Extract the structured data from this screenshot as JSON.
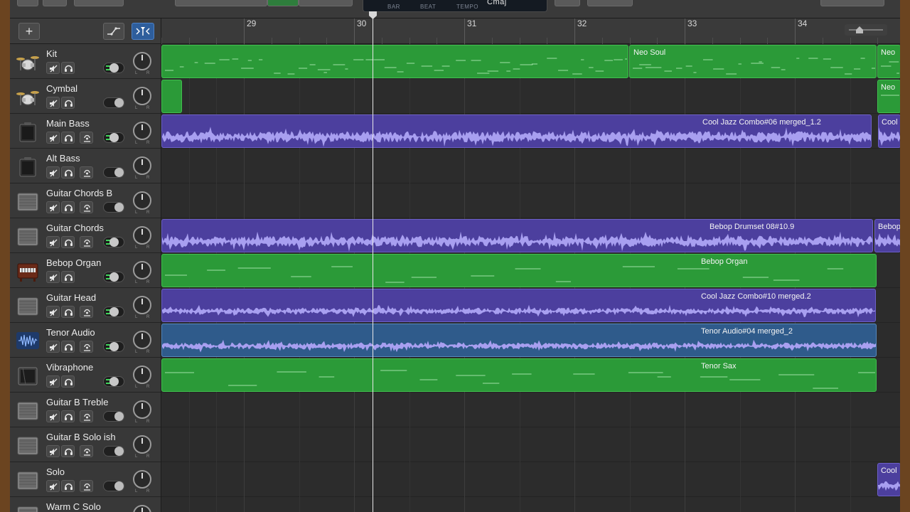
{
  "toolbar": {
    "lcd": {
      "bar_label": "BAR",
      "beat_label": "BEAT",
      "tempo_label": "TEMPO",
      "key": "Cmaj"
    }
  },
  "header_controls": {
    "add_symbol": "+"
  },
  "ruler": {
    "bars": [
      "29",
      "30",
      "31",
      "32",
      "33",
      "34"
    ]
  },
  "tracks": [
    {
      "name": "Kit",
      "icon": "drum-kit-icon",
      "toggle_on": true
    },
    {
      "name": "Cymbal",
      "icon": "drum-kit-icon",
      "toggle_on": false
    },
    {
      "name": "Main Bass",
      "icon": "bass-amp-icon",
      "toggle_on": true
    },
    {
      "name": "Alt Bass",
      "icon": "bass-amp-icon",
      "toggle_on": false
    },
    {
      "name": "Guitar Chords B",
      "icon": "guitar-amp-icon",
      "toggle_on": false
    },
    {
      "name": "Guitar Chords",
      "icon": "guitar-amp-icon",
      "toggle_on": true
    },
    {
      "name": "Bebop Organ",
      "icon": "organ-icon",
      "toggle_on": true
    },
    {
      "name": "Guitar Head",
      "icon": "guitar-amp-icon",
      "toggle_on": true
    },
    {
      "name": "Tenor Audio",
      "icon": "waveform-icon",
      "toggle_on": true
    },
    {
      "name": "Vibraphone",
      "icon": "vibraphone-amp-icon",
      "toggle_on": true
    },
    {
      "name": "Guitar B Treble",
      "icon": "guitar-amp-icon",
      "toggle_on": false
    },
    {
      "name": "Guitar B Solo ish",
      "icon": "guitar-amp-icon",
      "toggle_on": false
    },
    {
      "name": "Solo",
      "icon": "guitar-amp-icon",
      "toggle_on": false
    },
    {
      "name": "Warm C Solo",
      "icon": "guitar-amp-icon",
      "toggle_on": false
    }
  ],
  "regions": [
    {
      "track": "Kit",
      "label": "",
      "kind": "midi"
    },
    {
      "track": "Kit",
      "label": "Neo Soul",
      "kind": "midi"
    },
    {
      "track": "Kit",
      "label": "Neo",
      "kind": "midi"
    },
    {
      "track": "Cymbal",
      "label": "",
      "kind": "midi"
    },
    {
      "track": "Cymbal",
      "label": "Neo",
      "kind": "midi"
    },
    {
      "track": "Main Bass",
      "label": "Cool Jazz Combo#06 merged_1.2",
      "kind": "audio"
    },
    {
      "track": "Main Bass",
      "label": "Cool",
      "kind": "audio"
    },
    {
      "track": "Guitar Chords",
      "label": "Bebop Drumset 08#10.9",
      "kind": "audio"
    },
    {
      "track": "Guitar Chords",
      "label": "Bebop",
      "kind": "audio"
    },
    {
      "track": "Bebop Organ",
      "label": "Bebop Organ",
      "kind": "midi"
    },
    {
      "track": "Guitar Head",
      "label": "Cool Jazz Combo#10 merged.2",
      "kind": "audio"
    },
    {
      "track": "Tenor Audio",
      "label": "Tenor Audio#04 merged_2",
      "kind": "audio2"
    },
    {
      "track": "Vibraphone",
      "label": "Tenor Sax",
      "kind": "midi"
    },
    {
      "track": "Solo",
      "label": "Cool",
      "kind": "audio"
    }
  ]
}
